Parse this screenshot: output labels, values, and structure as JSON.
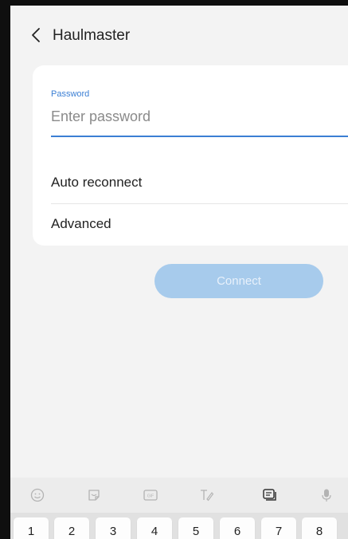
{
  "header": {
    "title": "Haulmaster"
  },
  "form": {
    "password_label": "Password",
    "password_placeholder": "Enter password",
    "password_value": "",
    "auto_reconnect_label": "Auto reconnect",
    "advanced_label": "Advanced"
  },
  "actions": {
    "connect_label": "Connect"
  },
  "keyboard": {
    "toolbar_icons": [
      "emoji-icon",
      "sticker-icon",
      "gif-icon",
      "handwriting-icon",
      "clipboard-icon",
      "mic-icon"
    ],
    "number_keys": [
      "1",
      "2",
      "3",
      "4",
      "5",
      "6",
      "7",
      "8"
    ]
  },
  "colors": {
    "accent": "#3b7fd4",
    "button_disabled": "#a7cbec"
  }
}
